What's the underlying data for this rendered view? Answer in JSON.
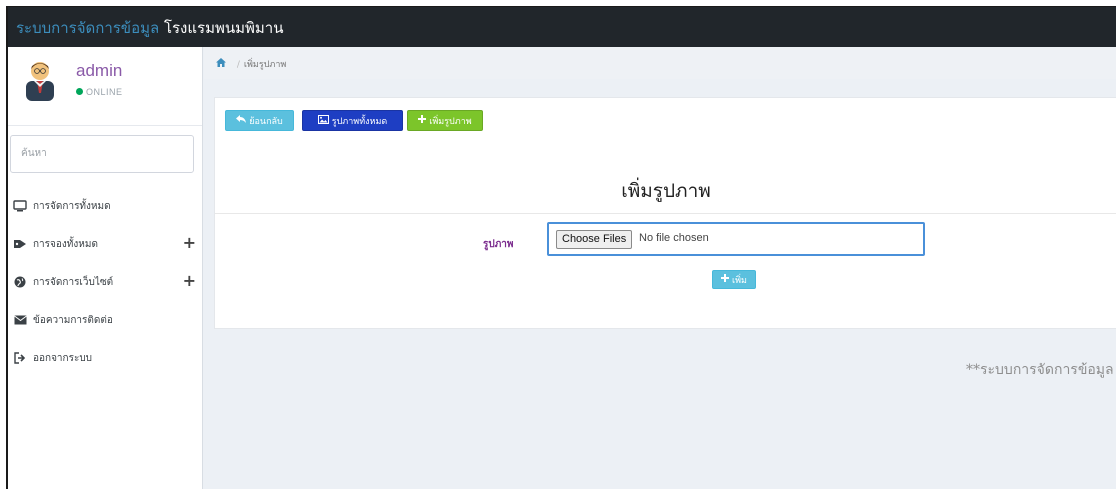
{
  "header": {
    "brand_colored": "ระบบการจัดการข้อมูล",
    "brand_white": "โรงแรมพนมพิมาน"
  },
  "user": {
    "name": "admin",
    "status": "ONLINE"
  },
  "search": {
    "placeholder": "ค้นหา"
  },
  "sidebar": {
    "items": [
      {
        "label": "การจัดการทั้งหมด",
        "icon": "desktop-icon",
        "expandable": false
      },
      {
        "label": "การจองทั้งหมด",
        "icon": "tag-icon",
        "expandable": true
      },
      {
        "label": "การจัดการเว็บไซต์",
        "icon": "globe-icon",
        "expandable": true
      },
      {
        "label": "ข้อความการติดต่อ",
        "icon": "envelope-icon",
        "expandable": false
      },
      {
        "label": "ออกจากระบบ",
        "icon": "sign-out-icon",
        "expandable": false
      }
    ],
    "expand_symbol": "+"
  },
  "breadcrumb": {
    "current": "เพิ่มรูปภาพ"
  },
  "toolbar": {
    "back_label": "ย้อนกลับ",
    "all_images_label": "รูปภาพทั้งหมด",
    "add_image_label": "เพิ่มรูปภาพ"
  },
  "form": {
    "title": "เพิ่มรูปภาพ",
    "field_label": "รูปภาพ",
    "file_button_label": "Choose Files",
    "file_status": "No file chosen",
    "submit_label": "เพิ่ม"
  },
  "footer": {
    "text": "**ระบบการจัดการข้อมูล โรงแรมพนมพิมาน"
  },
  "colors": {
    "accent": "#3c8dbc",
    "topbar": "#21262b",
    "btn_info": "#5bc0de",
    "btn_primary": "#1e3ec3",
    "btn_success": "#7cc52a",
    "online": "#00a65a"
  }
}
